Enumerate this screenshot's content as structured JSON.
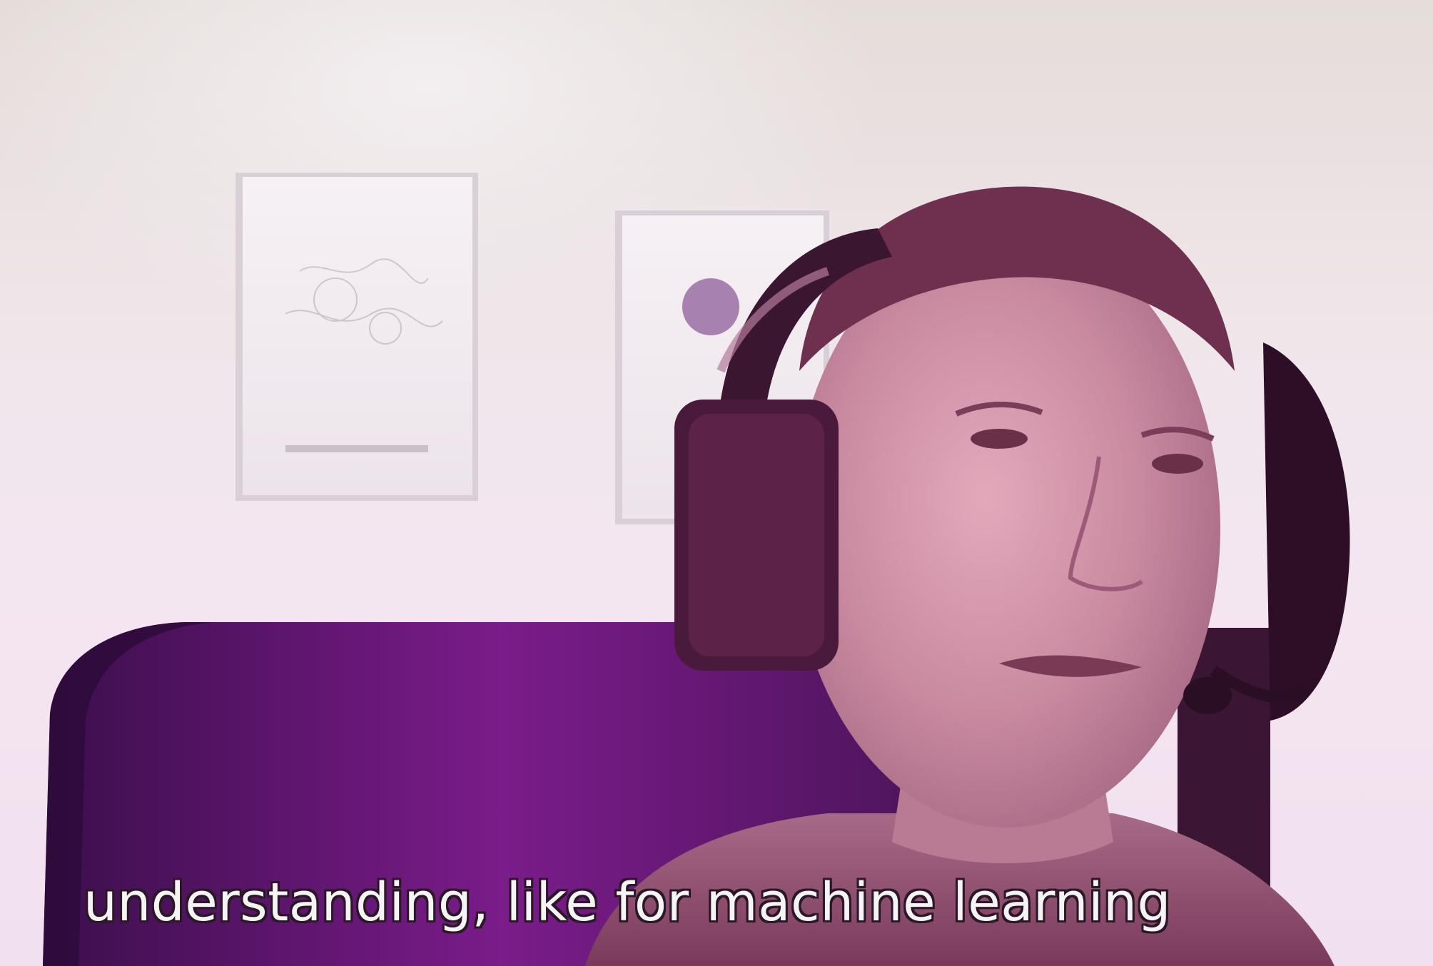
{
  "caption": {
    "text": "understanding, like for machine learning"
  },
  "colors": {
    "wall": "#efe6ea",
    "headboard": "#6a1a78",
    "shirt": "#8a4a6a",
    "skin": "#c98aa0",
    "headset": "#3a1630"
  }
}
